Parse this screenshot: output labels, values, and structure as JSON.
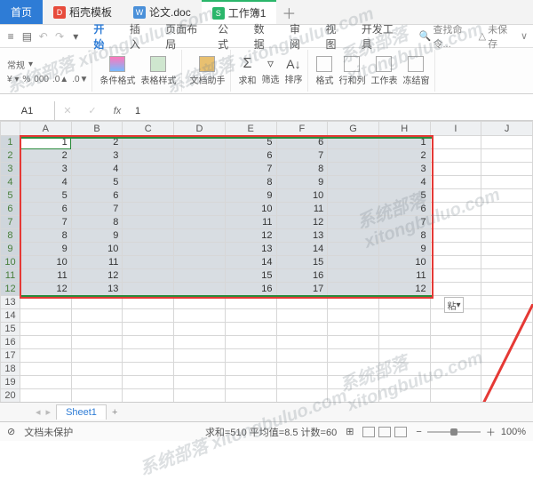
{
  "tabs": {
    "home": "首页",
    "items": [
      {
        "icon": "red",
        "label": "稻壳模板"
      },
      {
        "icon": "blue",
        "label": "论文.doc"
      },
      {
        "icon": "green",
        "label": "工作簿1"
      }
    ]
  },
  "menus": [
    "开始",
    "插入",
    "页面布局",
    "公式",
    "数据",
    "审阅",
    "视图",
    "开发工具"
  ],
  "right_links": {
    "search": "查找命令...",
    "unsave": "未保存",
    "down": "∨"
  },
  "ribbon": {
    "group1_label": "常规",
    "cond_format": "条件格式",
    "cell_style": "表格样式",
    "doc_helper": "文档助手",
    "sum": "求和",
    "filter": "筛选",
    "sort": "排序",
    "format": "格式",
    "row_col": "行和列",
    "worksheet": "工作表",
    "freeze": "冻结窗"
  },
  "formula": {
    "cell": "A1",
    "fx": "fx",
    "value": "1"
  },
  "columns": [
    "A",
    "B",
    "C",
    "D",
    "E",
    "F",
    "G",
    "H",
    "I",
    "J"
  ],
  "row_count_shown": 21,
  "chart_data": {
    "type": "table",
    "note": "Spreadsheet selection A1:H12; columns C, D blank; extra values H1=1, H12=12",
    "columns": [
      "A",
      "B",
      "C",
      "D",
      "E",
      "F",
      "G",
      "H"
    ],
    "rows": [
      [
        1,
        2,
        null,
        null,
        5,
        6,
        null,
        1
      ],
      [
        2,
        3,
        null,
        null,
        6,
        7,
        null,
        2
      ],
      [
        3,
        4,
        null,
        null,
        7,
        8,
        null,
        3
      ],
      [
        4,
        5,
        null,
        null,
        8,
        9,
        null,
        4
      ],
      [
        5,
        6,
        null,
        null,
        9,
        10,
        null,
        5
      ],
      [
        6,
        7,
        null,
        null,
        10,
        11,
        null,
        6
      ],
      [
        7,
        8,
        null,
        null,
        11,
        12,
        null,
        7
      ],
      [
        8,
        9,
        null,
        null,
        12,
        13,
        null,
        8
      ],
      [
        9,
        10,
        null,
        null,
        13,
        14,
        null,
        9
      ],
      [
        10,
        11,
        null,
        null,
        14,
        15,
        null,
        10
      ],
      [
        11,
        12,
        null,
        null,
        15,
        16,
        null,
        11
      ],
      [
        12,
        13,
        null,
        null,
        16,
        17,
        null,
        12
      ]
    ]
  },
  "paste_btn": "粘",
  "sheet": {
    "name": "Sheet1",
    "add": "+"
  },
  "status": {
    "protect": "文档未保护",
    "sum": "求和=510 平均值=8.5 计数=60",
    "zoom": "100%"
  }
}
